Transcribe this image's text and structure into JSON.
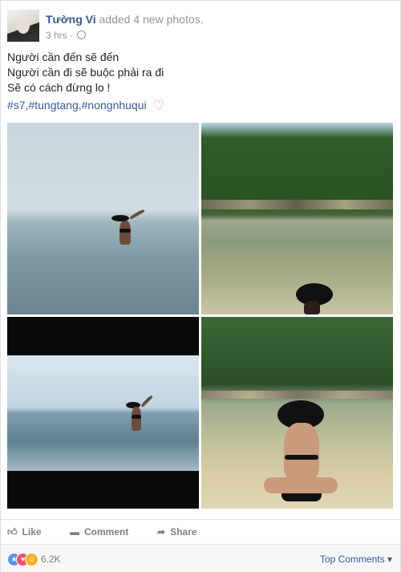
{
  "post": {
    "author": "Tường Vi",
    "action": "added 4 new photos.",
    "time": "3 hrs",
    "separator": "·",
    "lines": [
      "Người cần đến sẽ đến",
      "Người cần đi sẽ buộc phải ra đi",
      "Sẽ có cách đừng lo !"
    ],
    "hashtags": "#s7,#tungtang,#nongnhuqui",
    "heart_icon": "heart-icon"
  },
  "actions": {
    "like": "Like",
    "comment": "Comment",
    "share": "Share"
  },
  "reactions": {
    "count": "6.2K",
    "top_comments": "Top Comments",
    "top_comments_caret": "▾",
    "icons": [
      "like-reaction-icon",
      "love-reaction-icon",
      "haha-reaction-icon"
    ]
  },
  "colors": {
    "link": "#365899",
    "muted": "#90949c",
    "text": "#1d2129",
    "footer_bg": "#f6f7f9"
  }
}
